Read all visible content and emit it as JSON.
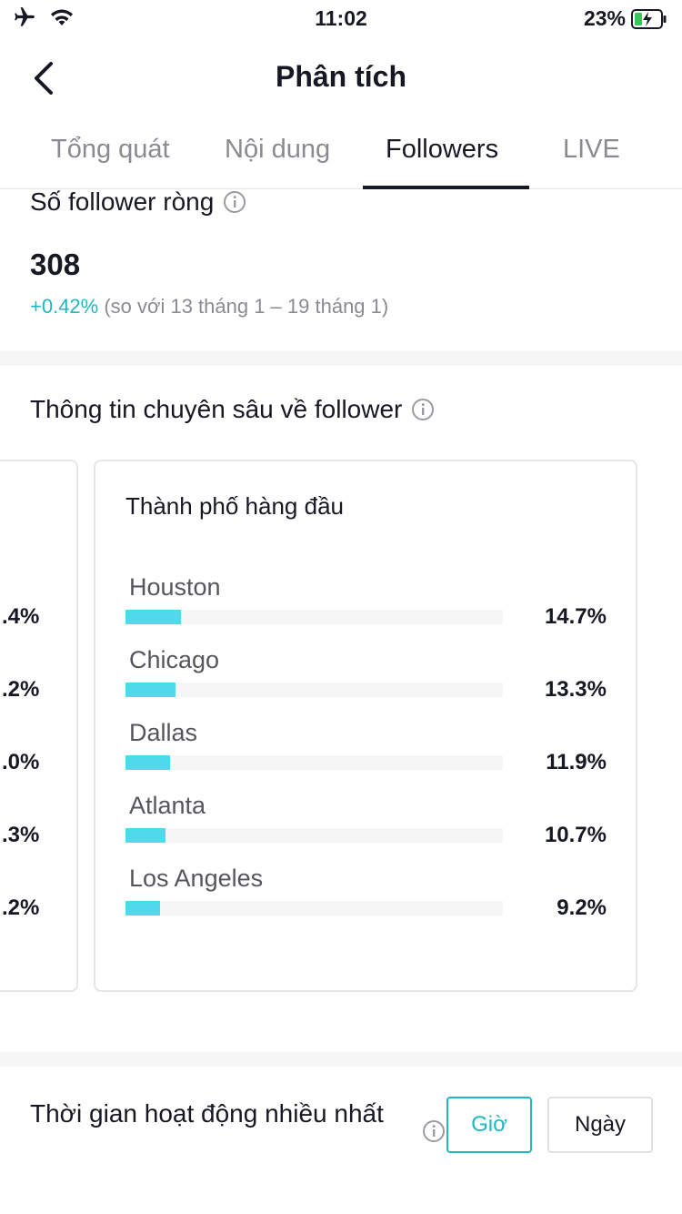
{
  "status_bar": {
    "time": "11:02",
    "battery": "23%",
    "icons": [
      "airplane-icon",
      "wifi-icon",
      "battery-charging-icon"
    ]
  },
  "header": {
    "title": "Phân tích",
    "back_icon": "chevron-left-icon"
  },
  "tabs": [
    {
      "label": "Tổng quát",
      "active": false
    },
    {
      "label": "Nội dung",
      "active": false
    },
    {
      "label": "Followers",
      "active": true
    },
    {
      "label": "LIVE",
      "active": false
    }
  ],
  "net_followers": {
    "title": "Số follower ròng",
    "value": "308",
    "change_pct": "+0.42%",
    "change_note": "(so với 13 tháng 1 – 19 tháng 1)"
  },
  "insights": {
    "title": "Thông tin chuyên sâu về follower",
    "previous_card_pcts": [
      ".4%",
      ".2%",
      ".0%",
      ".3%",
      ".2%"
    ],
    "top_cities": {
      "title": "Thành phố hàng đầu",
      "items": [
        {
          "name": "Houston",
          "pct": "14.7%",
          "value": 14.7
        },
        {
          "name": "Chicago",
          "pct": "13.3%",
          "value": 13.3
        },
        {
          "name": "Dallas",
          "pct": "11.9%",
          "value": 11.9
        },
        {
          "name": "Atlanta",
          "pct": "10.7%",
          "value": 10.7
        },
        {
          "name": "Los Angeles",
          "pct": "9.2%",
          "value": 9.2
        }
      ]
    }
  },
  "active_time": {
    "title": "Thời gian hoạt động nhiều nhất",
    "hour_label": "Giờ",
    "day_label": "Ngày"
  },
  "colors": {
    "accent": "#20b8c2",
    "bar": "#4fd9ec",
    "text": "#161823",
    "muted": "#8a8b91"
  }
}
